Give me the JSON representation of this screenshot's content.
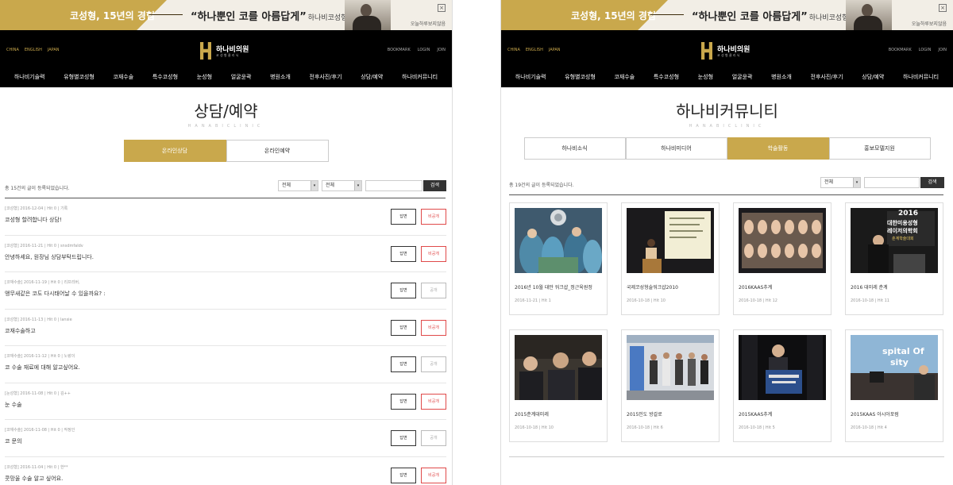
{
  "banner": {
    "left_text_dark": "코성형, ",
    "left_text_light": "15년의 경험",
    "slogan": "“하나뿐인 코를 아름답게”",
    "clinic": "하나비코성형클리닉",
    "close": "×",
    "today": "오늘하루보지않음"
  },
  "header": {
    "langs": [
      "CHINA",
      "ENGLISH",
      "JAPAN"
    ],
    "utils": [
      "BOOKMARK",
      "LOGIN",
      "JOIN"
    ],
    "logo_name": "하나비의원",
    "logo_sub": "코 성 형 클 리 닉",
    "nav": [
      "하나비기술력",
      "유형별코성형",
      "코재수술",
      "특수코성형",
      "눈성형",
      "얼굴윤곽",
      "병원소개",
      "전후사진/후기",
      "상담/예약",
      "하나비커뮤니티"
    ]
  },
  "consult": {
    "title": "상담/예약",
    "subtitle": "HANABICLINIC",
    "tabs": [
      "온라인상담",
      "온라인예약"
    ],
    "count": "총 15건의 글이 등록되었습니다.",
    "select1": "전체",
    "select2": "전체",
    "search_label": "검색",
    "reply_label": "답변",
    "private_label": "비공개",
    "public_label": "공개",
    "posts": [
      {
        "meta": "[코성형] 2016-12-04 | Hit 0 | 기록",
        "subject": "코성형 할려합니다 상담!",
        "private": true
      },
      {
        "meta": "[코성형] 2016-11-21 | Hit 0 | snsdmfaldv",
        "subject": "안녕하세요, 원장님 상담부탁드립니다.",
        "private": true
      },
      {
        "meta": "[코재수술] 2016-11-19 | Hit 0 | 리프리버,",
        "subject": "앵무새같은 코도 다시태어날 수 있을까요? :",
        "private": false
      },
      {
        "meta": "[코성형] 2016-11-13 | Hit 0 | lansie",
        "subject": "코재수술하고",
        "private": true
      },
      {
        "meta": "[코재수술] 2016-11-12 | Hit 0 | 노랑이",
        "subject": "코 수술 재료에 대해 알고싶어요.",
        "private": false
      },
      {
        "meta": "[눈성형] 2016-11-08 | Hit 0 | 김++",
        "subject": "눈 수술",
        "private": true
      },
      {
        "meta": "[코재수술] 2016-11-08 | Hit 0 | 작정인",
        "subject": "코 문의",
        "private": false
      },
      {
        "meta": "[코성형] 2016-11-04 | Hit 0 | 한**",
        "subject": "콧망울 수술 알고 싶어요.",
        "private": true
      }
    ]
  },
  "community": {
    "title": "하나비커뮤니티",
    "subtitle": "HANABICLINIC",
    "tabs": [
      "하나비소식",
      "하나비미디어",
      "학술활동",
      "홍보모델지원"
    ],
    "count": "총 19건의 글이 등록되었습니다.",
    "select1": "전체",
    "search_label": "검색",
    "items": [
      {
        "title": "2016년 10월 대만 워크샵_정근육원정",
        "meta": "2016-11-21 | Hit 1"
      },
      {
        "title": "국제코성형술워크샵2010",
        "meta": "2016-10-18 | Hit 10"
      },
      {
        "title": "2016KAAS추계",
        "meta": "2016-10-18 | Hit 12"
      },
      {
        "title": "2016 대미레 춘계",
        "meta": "2016-10-18 | Hit 11"
      },
      {
        "title": "2015춘계대미레",
        "meta": "2016-10-18 | Hit 10"
      },
      {
        "title": "2015인도 방갈로",
        "meta": "2016-10-18 | Hit 6"
      },
      {
        "title": "2015KAAS추계",
        "meta": "2016-10-18 | Hit 5"
      },
      {
        "title": "2015KAAS 아시아포럼",
        "meta": "2016-10-18 | Hit 4"
      }
    ],
    "photo_texts": {
      "p4_year": "2016",
      "p4_line1": "대한미용성형",
      "p4_line2": "레이저의학회",
      "p4_line3": "춘계학술대회",
      "p8_text": "spital Of",
      "p8_text2": "sity"
    }
  }
}
